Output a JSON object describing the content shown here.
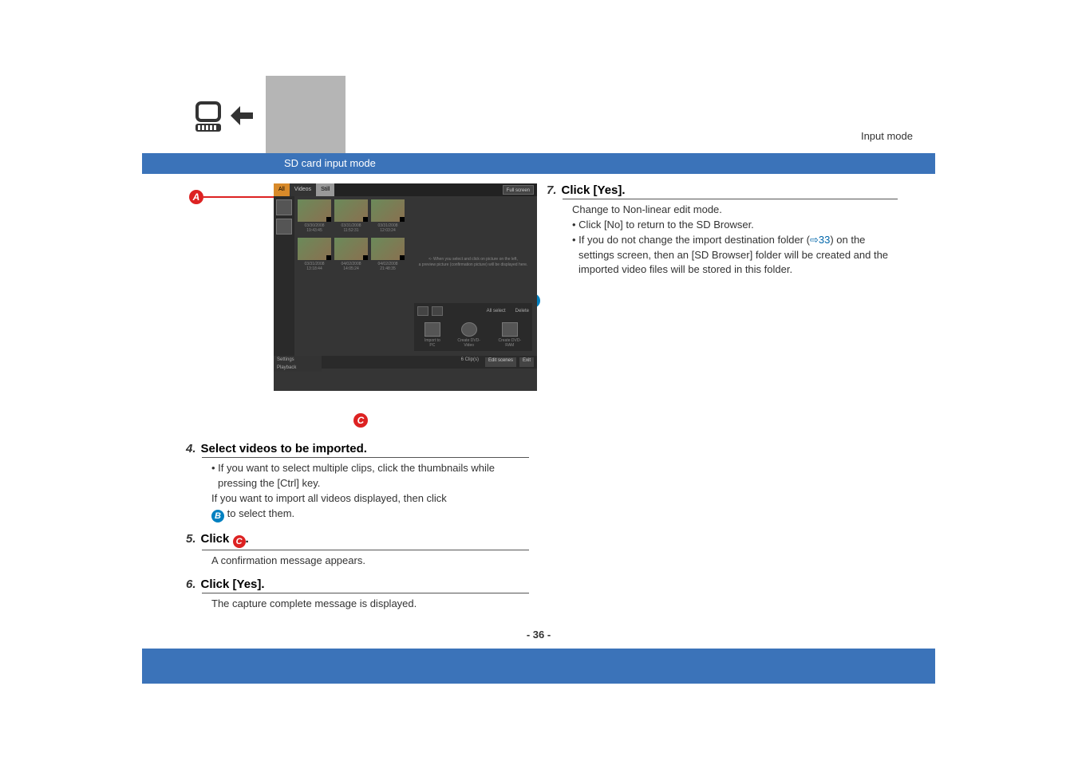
{
  "header": {
    "mode_label": "Input mode",
    "section_title": "SD card input mode"
  },
  "markers": {
    "a": "A",
    "b": "B",
    "c": "C"
  },
  "sd_window": {
    "tab_all": "All",
    "tab_videos": "Videos",
    "tab_still": "Still",
    "full_screen": "Full screen",
    "preview_hint_l1": "<- When you select and click on picture on the left,",
    "preview_hint_l2": "a preview picture (confirmation picture) will be displayed here.",
    "thumbs_r1": [
      "03/30/2008 19:43:45",
      "03/31/2008 11:52:31",
      "03/31/2008 12:03:24"
    ],
    "thumbs_r2": [
      "03/31/2008 13:18:44",
      "04/02/2008 14:05:24",
      "04/02/2008 21:48:35"
    ],
    "all_select": "All select",
    "delete": "Delete",
    "action1": "Import to PC",
    "action2": "Create DVD-Video",
    "action3": "Create DVD-RAM",
    "bot_settings": "Settings",
    "bot_playback": "Playback",
    "clips": "6 Clip(s)",
    "edit_scenes": "Edit scenes",
    "exit": "Exit"
  },
  "steps": {
    "s4": {
      "num": "4.",
      "title": "Select videos to be imported.",
      "line1": "• If you want to select multiple clips, click the thumbnails while pressing the [Ctrl] key.",
      "line2": "If you want to import all videos displayed, then click",
      "line3": " to select them."
    },
    "s5": {
      "num": "5.",
      "title_pre": "Click ",
      "title_post": ".",
      "body": "A confirmation message appears."
    },
    "s6": {
      "num": "6.",
      "title": "Click [Yes].",
      "body": "The capture complete message is displayed."
    },
    "s7": {
      "num": "7.",
      "title": "Click [Yes].",
      "line1": "Change to Non-linear edit mode.",
      "line2": "• Click [No] to return to the SD Browser.",
      "line3a": "• If you do not change the import destination folder (",
      "link_arrow": "⇨",
      "link_num": "33",
      "line3b": ") on the settings screen, then an [SD Browser] folder will be created and the imported video files will be stored in this folder."
    }
  },
  "page_number": "- 36 -"
}
